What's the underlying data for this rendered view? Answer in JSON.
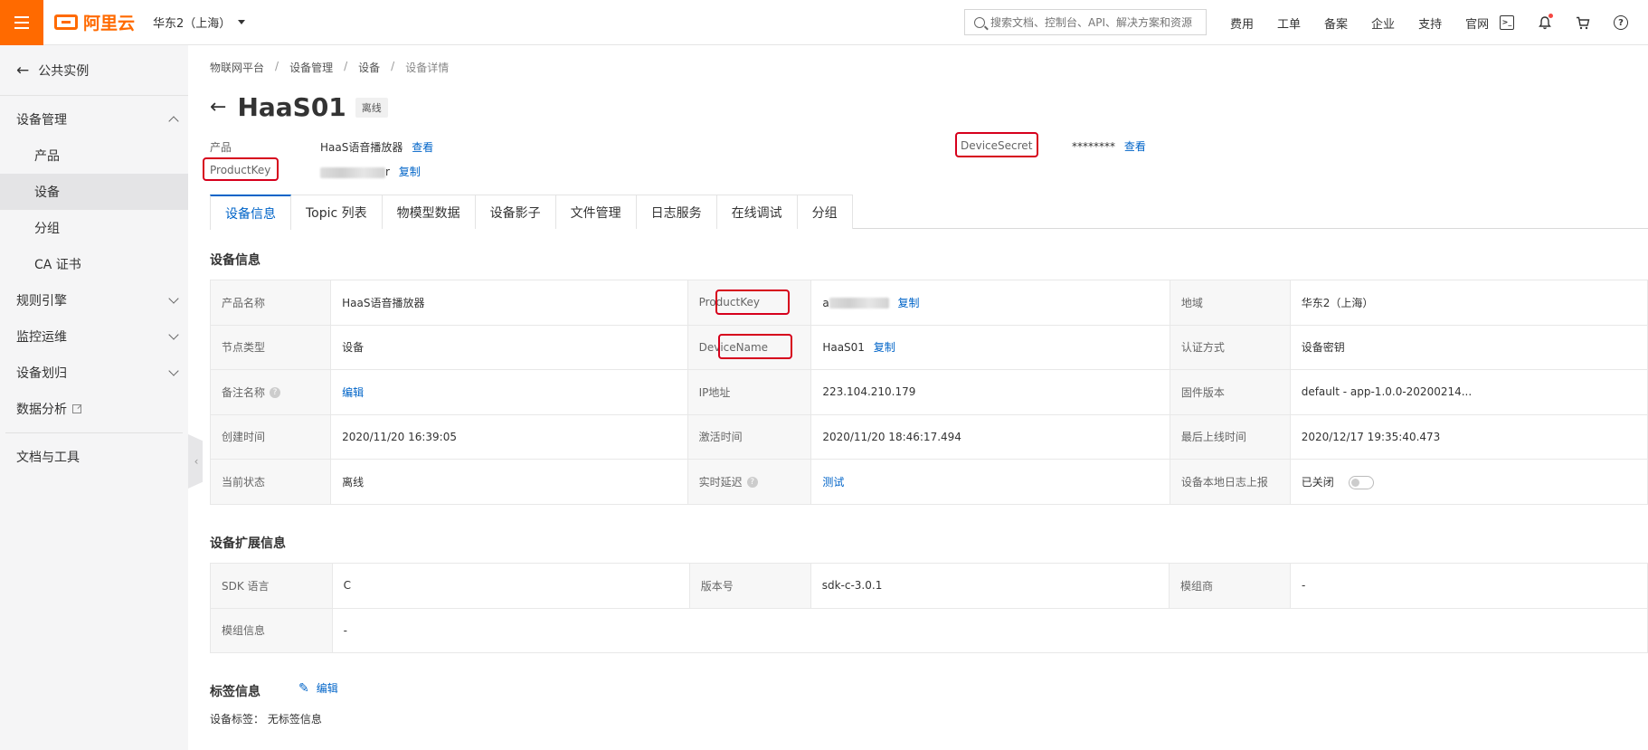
{
  "header": {
    "logo_text": "阿里云",
    "region": "华东2（上海）",
    "search_placeholder": "搜索文档、控制台、API、解决方案和资源",
    "nav": [
      "费用",
      "工单",
      "备案",
      "企业",
      "支持",
      "官网"
    ],
    "icons": [
      "terminal-icon",
      "bell-icon",
      "cart-icon",
      "help-icon"
    ],
    "accent": "#ff6a00"
  },
  "sidebar": {
    "back_label": "公共实例",
    "groups": [
      {
        "label": "设备管理",
        "expanded": true
      },
      {
        "label": "规则引擎",
        "expanded": false
      },
      {
        "label": "监控运维",
        "expanded": false
      },
      {
        "label": "设备划归",
        "expanded": false
      }
    ],
    "items": [
      "产品",
      "设备",
      "分组",
      "CA 证书"
    ],
    "active_item": "设备",
    "data_analysis": "数据分析",
    "docs_tools": "文档与工具"
  },
  "breadcrumb": [
    "物联网平台",
    "设备管理",
    "设备",
    "设备详情"
  ],
  "device": {
    "name": "HaaS01",
    "status": "离线",
    "product_label": "产品",
    "product_value": "HaaS语音播放器",
    "view_link": "查看",
    "productkey_label": "ProductKey",
    "productkey_tail": "r",
    "copy_link": "复制",
    "devicesecret_label": "DeviceSecret",
    "devicesecret_value": "********",
    "devicesecret_view": "查看"
  },
  "tabs": [
    "设备信息",
    "Topic 列表",
    "物模型数据",
    "设备影子",
    "文件管理",
    "日志服务",
    "在线调试",
    "分组"
  ],
  "device_info": {
    "title": "设备信息",
    "rows": [
      {
        "l1": "产品名称",
        "v1": "HaaS语音播放器",
        "l2": "ProductKey",
        "v2": "a",
        "l3": "地域",
        "v3": "华东2（上海）"
      },
      {
        "l1": "节点类型",
        "v1": "设备",
        "l2": "DeviceName",
        "v2": "HaaS01",
        "l3": "认证方式",
        "v3": "设备密钥"
      },
      {
        "l1": "备注名称",
        "v1": "编辑",
        "l2": "IP地址",
        "v2": "223.104.210.179",
        "l3": "固件版本",
        "v3": "default - app-1.0.0-20200214..."
      },
      {
        "l1": "创建时间",
        "v1": "2020/11/20 16:39:05",
        "l2": "激活时间",
        "v2": "2020/11/20 18:46:17.494",
        "l3": "最后上线时间",
        "v3": "2020/12/17 19:35:40.473"
      },
      {
        "l1": "当前状态",
        "v1": "离线",
        "l2": "实时延迟",
        "v2": "测试",
        "l3": "设备本地日志上报",
        "v3": "已关闭"
      }
    ],
    "copy_link": "复制"
  },
  "ext_info": {
    "title": "设备扩展信息",
    "rows": [
      {
        "l1": "SDK 语言",
        "v1": "C",
        "l2": "版本号",
        "v2": "sdk-c-3.0.1",
        "l3": "模组商",
        "v3": "-"
      },
      {
        "l1": "模组信息",
        "v1": "-"
      }
    ]
  },
  "tags": {
    "title": "标签信息",
    "edit_label": "编辑",
    "tag_label": "设备标签：",
    "tag_value": "无标签信息"
  }
}
